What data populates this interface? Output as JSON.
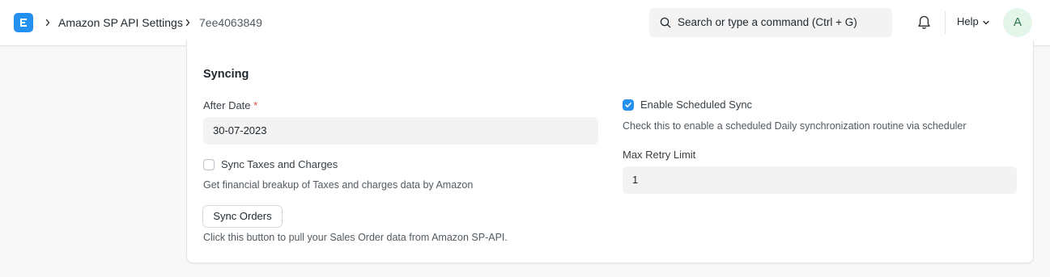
{
  "breadcrumb": {
    "items": [
      "Amazon SP API Settings",
      "7ee4063849"
    ]
  },
  "search": {
    "placeholder": "Search or type a command (Ctrl + G)"
  },
  "navbar": {
    "help_label": "Help",
    "avatar_initial": "A"
  },
  "section": {
    "title": "Syncing",
    "after_date": {
      "label": "After Date",
      "required_mark": "*",
      "value": "30-07-2023"
    },
    "sync_taxes": {
      "label": "Sync Taxes and Charges",
      "checked": false,
      "description": "Get financial breakup of Taxes and charges data by Amazon"
    },
    "sync_orders": {
      "button_label": "Sync Orders",
      "description": "Click this button to pull your Sales Order data from Amazon SP-API."
    },
    "scheduled_sync": {
      "label": "Enable Scheduled Sync",
      "checked": true,
      "description": "Check this to enable a scheduled Daily synchronization routine via scheduler"
    },
    "max_retry": {
      "label": "Max Retry Limit",
      "value": "1"
    }
  },
  "icons": {
    "app_logo": "erpnext-logo-icon",
    "search": "search-icon",
    "notification": "bell-icon",
    "dropdown": "chevron-down-icon",
    "breadcrumb_separator": "chevron-right-icon",
    "checkbox_checked": "check-icon"
  },
  "colors": {
    "accent": "#2490ef",
    "required": "#e24c4c",
    "avatar_bg": "#e4f5e9",
    "avatar_text": "#2d7a4a"
  }
}
